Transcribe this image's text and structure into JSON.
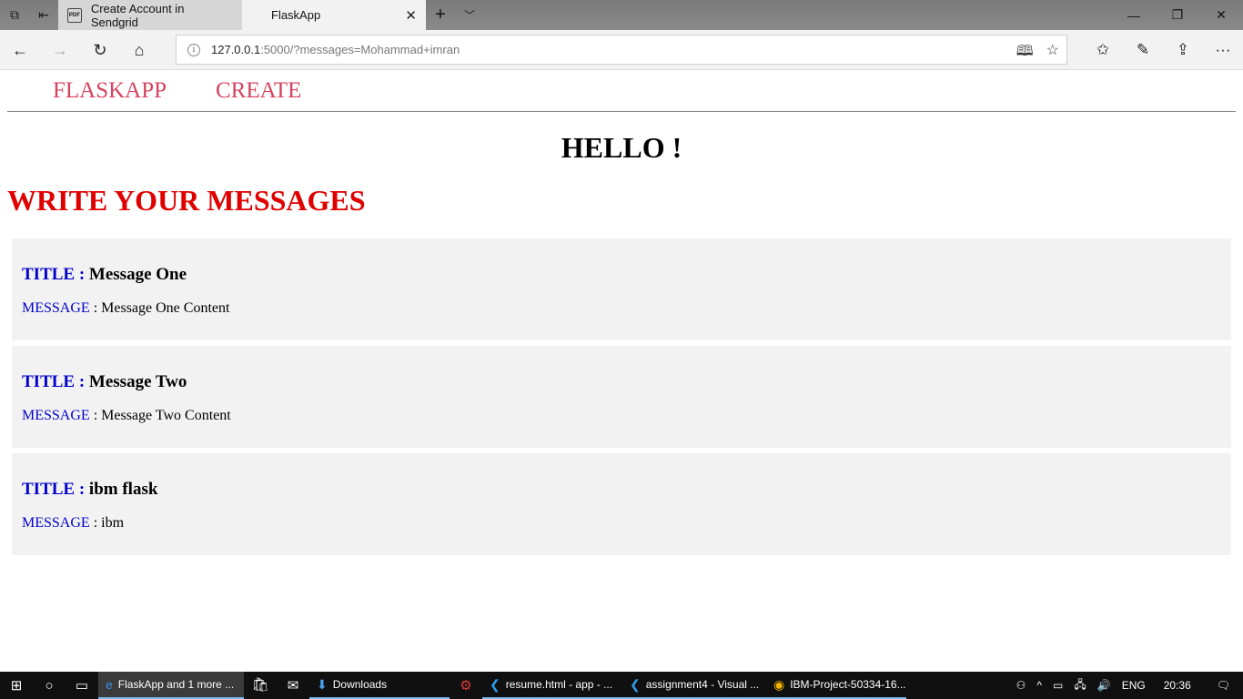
{
  "browser": {
    "tabs": [
      {
        "title": "Create Account in Sendgrid",
        "icon": "pdf-icon"
      },
      {
        "title": "FlaskApp",
        "icon": ""
      }
    ],
    "url_host": "127.0.0.1",
    "url_rest": ":5000/?messages=Mohammad+imran"
  },
  "page": {
    "nav": {
      "brand": "FLASKAPP",
      "create": "CREATE"
    },
    "hello": "HELLO !",
    "heading": "WRITE YOUR MESSAGES",
    "title_label": "TITLE :",
    "message_label": "MESSAGE",
    "message_sep": " : ",
    "messages": [
      {
        "title": "Message One",
        "content": "Message One Content"
      },
      {
        "title": "Message Two",
        "content": "Message Two Content"
      },
      {
        "title": "ibm flask",
        "content": "ibm"
      }
    ]
  },
  "taskbar": {
    "apps": [
      {
        "label": "FlaskApp and 1 more ...",
        "icon": "edge-icon"
      },
      {
        "label": "Downloads",
        "icon": "download-icon"
      },
      {
        "label": "resume.html - app - ...",
        "icon": "vscode-icon"
      },
      {
        "label": "assignment4 - Visual ...",
        "icon": "vscode-icon"
      },
      {
        "label": "IBM-Project-50334-16...",
        "icon": "chrome-icon"
      }
    ],
    "lang": "ENG",
    "time": "20:36"
  },
  "colors": {
    "nav_link": "#d5435e",
    "heading_red": "#e00000",
    "label_blue": "#0000cc",
    "card_bg": "#f2f2f2"
  }
}
